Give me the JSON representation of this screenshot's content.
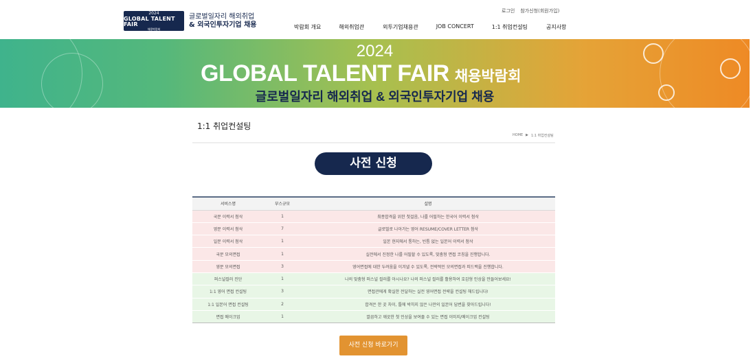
{
  "header": {
    "logo": {
      "year": "2024",
      "title": "GLOBAL TALENT FAIR",
      "small": "채용박람회",
      "line1": "글로벌일자리 해외취업",
      "line2": "& 외국인투자기업 채용"
    },
    "top_links": [
      "로그인",
      "참가신청(회원가입)"
    ],
    "nav": [
      "박람회 개요",
      "해외취업관",
      "외투기업채용관",
      "JOB CONCERT",
      "1:1 취업컨설팅",
      "공지사항"
    ]
  },
  "banner": {
    "year": "2024",
    "title": "GLOBAL TALENT FAIR",
    "title_suffix": "채용박람회",
    "subtitle": "글로벌일자리 해외취업 & 외국인투자기업 채용"
  },
  "page": {
    "title": "1:1 취업컨설팅",
    "breadcrumb": [
      "HOME",
      "▶",
      "1:1 취업컨설팅"
    ],
    "pill": "사전 신청",
    "cta": "사전 신청 바로가기"
  },
  "table": {
    "headers": [
      "서비스명",
      "부스규모",
      "설명"
    ],
    "rows": [
      {
        "name": "국문 이력서 첨삭",
        "size": "1",
        "desc": "최종합격을 위한 첫걸음, 나를 어필하는 한국어 이력서 첨삭",
        "tone": "pink"
      },
      {
        "name": "영문 이력서 첨삭",
        "size": "7",
        "desc": "글로벌로 나아가는 영어 RESUME/COVER LETTER 첨삭",
        "tone": "pink"
      },
      {
        "name": "일문 이력서 첨삭",
        "size": "1",
        "desc": "일본 현지에서 통하는, 빈틈 없는 일본어 이력서 첨삭",
        "tone": "pink"
      },
      {
        "name": "국문 모의면접",
        "size": "1",
        "desc": "실전에서 진정한 나를 어필할 수 있도록, 맞춤형 면접 코칭을 진행합니다.",
        "tone": "pink"
      },
      {
        "name": "영문 모의면접",
        "size": "3",
        "desc": "영어면접에 대한 두려움을 이겨낼 수 있도록, 전략적인 모의면접과 피드백을 진행합니다.",
        "tone": "pink"
      },
      {
        "name": "퍼스널컬러 진단",
        "size": "1",
        "desc": "나의 맞춤형 퍼스널 컬러를 아시나요? 나의 퍼스널 컬러를 활용하여 호감형 인상을 만들어보세요!",
        "tone": "green"
      },
      {
        "name": "1:1 영어 면접 컨설팅",
        "size": "3",
        "desc": "면접관에게 확실한 전달하는 실전 영어면접 전략을 컨설팅 해드립니다!",
        "tone": "green"
      },
      {
        "name": "1:1 일본어 면접 컨설팅",
        "size": "2",
        "desc": "합격은 한 끗 차이, 틀에 박히지 않은 나만의 일본어 답변을 찾아드립니다!",
        "tone": "green"
      },
      {
        "name": "면접 메이크업",
        "size": "1",
        "desc": "깔끔하고 깨끗한 첫 인상을 보여줄 수 있는 면접 이미지/메이크업 컨설팅",
        "tone": "green"
      }
    ]
  },
  "colors": {
    "navy": "#16284e",
    "orange": "#e29331",
    "pink_row": "#fbe7e7",
    "green_row": "#e8f6e6"
  }
}
